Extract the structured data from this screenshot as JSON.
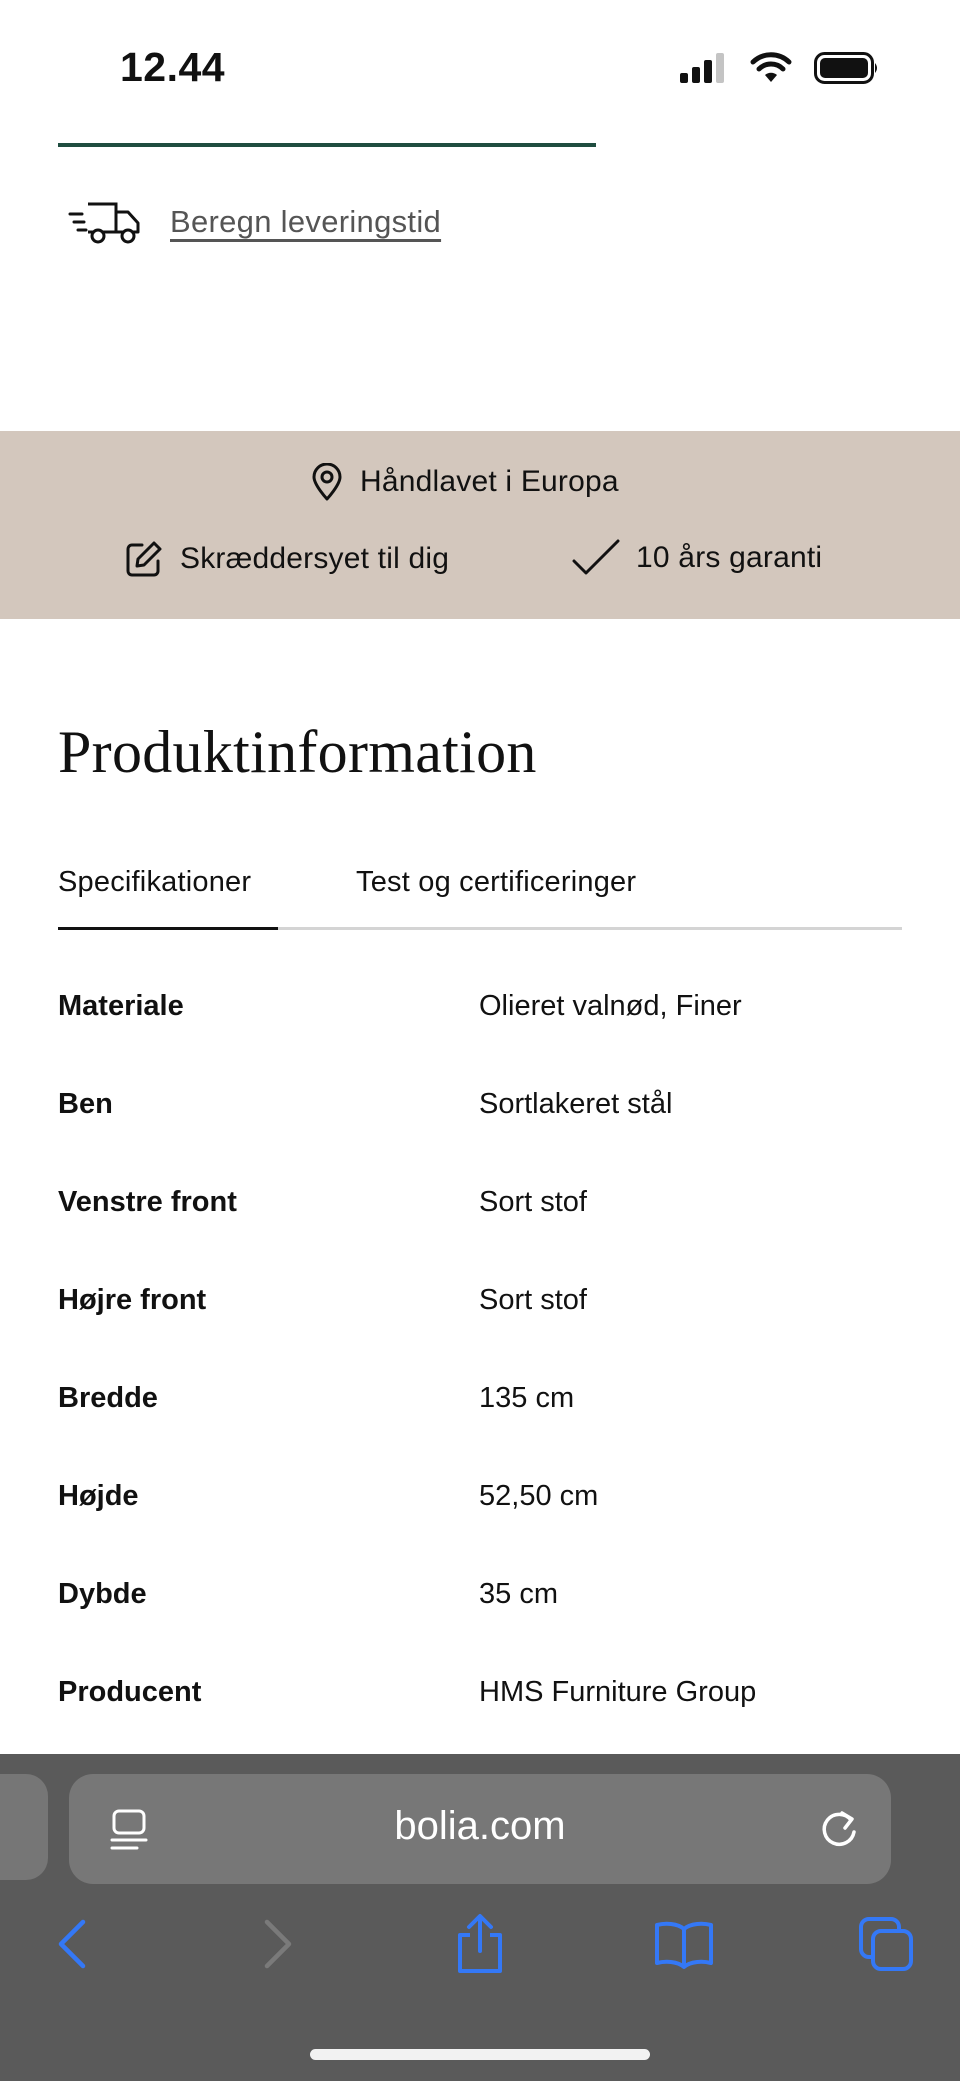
{
  "status_bar": {
    "time": "12.44"
  },
  "delivery": {
    "link_label": "Beregn leveringstid",
    "icon": "delivery-truck-icon"
  },
  "features": {
    "handmade": "Håndlavet i Europa",
    "tailored": "Skræddersyet til dig",
    "warranty": "10 års garanti"
  },
  "product_info": {
    "title": "Produktinformation",
    "tabs": [
      {
        "label": "Specifikationer",
        "active": true
      },
      {
        "label": "Test og certificeringer",
        "active": false
      }
    ],
    "specs": [
      {
        "label": "Materiale",
        "value": "Olieret valnød, Finer"
      },
      {
        "label": "Ben",
        "value": "Sortlakeret stål"
      },
      {
        "label": "Venstre front",
        "value": "Sort stof"
      },
      {
        "label": "Højre front",
        "value": "Sort stof"
      },
      {
        "label": "Bredde",
        "value": "135 cm"
      },
      {
        "label": "Højde",
        "value": "52,50 cm"
      },
      {
        "label": "Dybde",
        "value": "35 cm"
      },
      {
        "label": "Producent",
        "value": "HMS Furniture Group"
      }
    ]
  },
  "browser": {
    "url": "bolia.com",
    "accent_color": "#3478f6",
    "toolbar_icons": [
      "back-icon",
      "forward-icon",
      "share-icon",
      "bookmarks-icon",
      "tabs-icon"
    ]
  },
  "colors": {
    "progress": "#1f4d40",
    "feature_band": "#d3c7bd",
    "browser_chrome": "#5a5a5a"
  }
}
